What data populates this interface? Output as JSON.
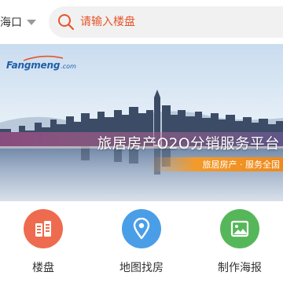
{
  "header": {
    "city": "海口",
    "search_placeholder": "请输入楼盘"
  },
  "banner": {
    "logo_text": "Fangmeng",
    "logo_domain": ".com",
    "title": "旅居房产O2O分销服务平台",
    "subtitle": "旅居房产 · 服务全国"
  },
  "quick_links": [
    {
      "label": "楼盘",
      "icon": "building-icon",
      "color": "#ee6b4f"
    },
    {
      "label": "地图找房",
      "icon": "map-pin-icon",
      "color": "#4a9ee8"
    },
    {
      "label": "制作海报",
      "icon": "image-icon",
      "color": "#56b75a"
    }
  ]
}
